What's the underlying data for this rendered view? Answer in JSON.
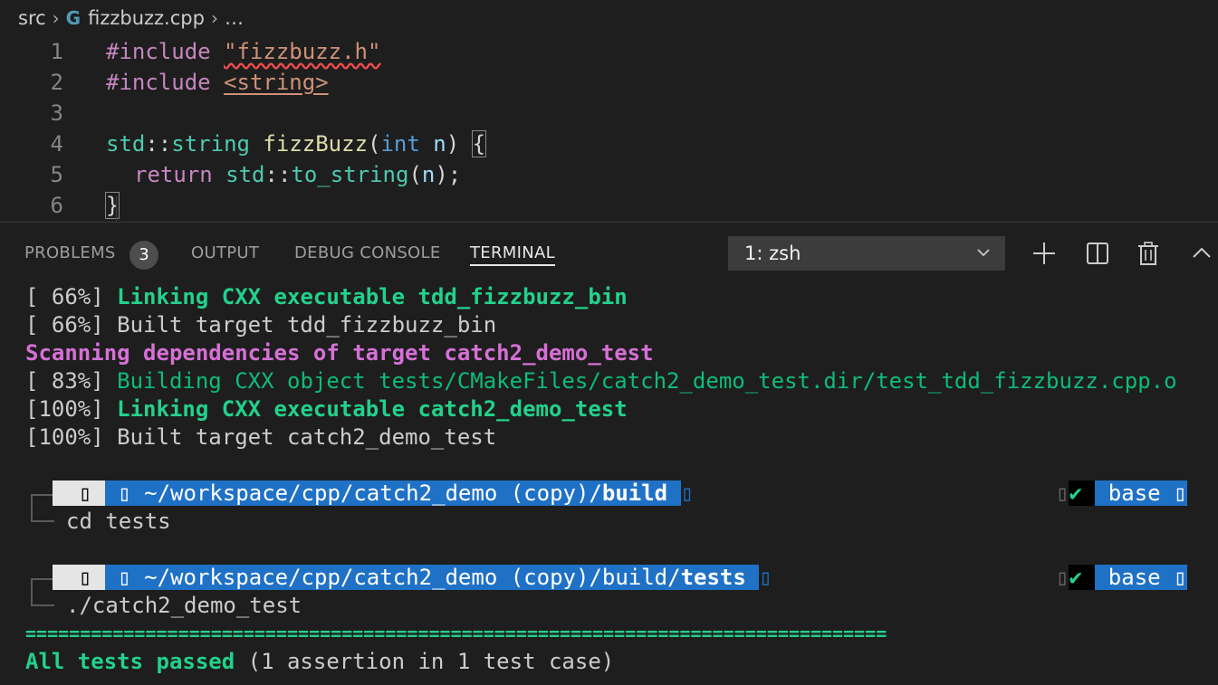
{
  "breadcrumb": {
    "folder": "src",
    "file": "fizzbuzz.cpp",
    "more": "…",
    "file_icon": "cpp-file-icon"
  },
  "editor": {
    "lines": [
      {
        "num": "1",
        "p1": "#include ",
        "p2": "\"fizzbuzz.h\""
      },
      {
        "num": "2",
        "p1": "#include ",
        "p2": "<string>"
      },
      {
        "num": "3"
      },
      {
        "num": "4",
        "ns": "std",
        "sep": "::",
        "type": "string",
        "fn": " fizzBuzz",
        "paren_open": "(",
        "param_type": "int",
        "param": " n",
        "close": ") ",
        "brace": "{"
      },
      {
        "num": "5",
        "kw": "return",
        "ns": " std",
        "sep": "::",
        "fn": "to_string",
        "open": "(",
        "arg": "n",
        "close": ");"
      },
      {
        "num": "6",
        "brace": "}"
      }
    ]
  },
  "panel": {
    "tabs": {
      "problems": "PROBLEMS",
      "problems_count": "3",
      "output": "OUTPUT",
      "debug": "DEBUG CONSOLE",
      "terminal": "TERMINAL"
    },
    "terminal_select": "1: zsh",
    "icons": [
      "plus-icon",
      "split-icon",
      "trash-icon",
      "chevron-up-icon"
    ]
  },
  "terminal": {
    "l1_prefix": "[ 66%] ",
    "l1_text": "Linking CXX executable tdd_fizzbuzz_bin",
    "l2": "[ 66%] Built target tdd_fizzbuzz_bin",
    "l3": "Scanning dependencies of target catch2_demo_test",
    "l4_prefix": "[ 83%] ",
    "l4_text": "Building CXX object tests/CMakeFiles/catch2_demo_test.dir/test_tdd_fizzbuzz.cpp.o",
    "l5_prefix": "[100%] ",
    "l5_text": "Linking CXX executable catch2_demo_test",
    "l6": "[100%] Built target catch2_demo_test",
    "prompt1_path": " ~/workspace/cpp/catch2_demo (copy)/",
    "prompt1_dir": "build",
    "cmd1": "cd tests",
    "prompt2_path": " ~/workspace/cpp/catch2_demo (copy)/build/",
    "prompt2_dir": "tests",
    "cmd2": "./catch2_demo_test",
    "check": "✔",
    "env": " base ",
    "rule": "===============================================================================",
    "result_bold": "All tests passed",
    "result_rest": " (1 assertion in 1 test case)"
  }
}
